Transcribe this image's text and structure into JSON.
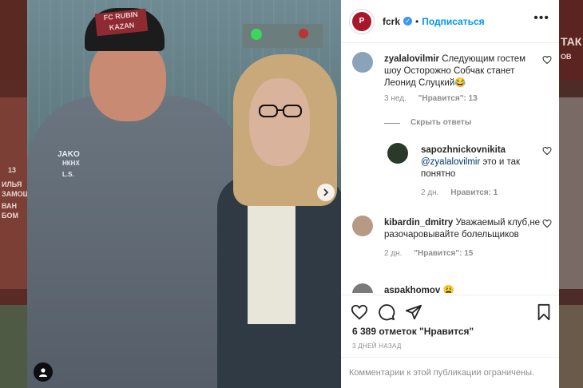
{
  "post": {
    "username": "fcrk",
    "follow_label": "Подписаться",
    "more_label": "•••",
    "dot": "•",
    "verified_mark": "✓",
    "club_emblem_text": "Р",
    "cap_text": "FC RUBIN KAZAN",
    "jacket_brand": "JAKO",
    "jacket_sponsor": "НКНХ",
    "jacket_initials": "L.S."
  },
  "comments": [
    {
      "username": "zyalalovilmir",
      "text": "Следующим гостем шоу Осторожно Собчак станет Леонид Слуцкий😂",
      "time": "3 нед.",
      "likes": "\"Нравится\": 13"
    },
    {
      "username": "sapozhnickovnikita",
      "mention": "@zyalalovilmir",
      "text": " это и так понятно",
      "time": "2 дн.",
      "likes": "Нравится: 1"
    },
    {
      "username": "kibardin_dmitry",
      "text": "Уважаемый клуб,не разочаровывайте болельщиков",
      "time": "2 дн.",
      "likes": "\"Нравится\": 15"
    },
    {
      "username": "aspakhomov",
      "text": " 😩"
    }
  ],
  "hide_replies_label": "Скрыть ответы",
  "likes_count": "6 389 отметок \"Нравится\"",
  "date_label": "3 ДНЕЙ НАЗАД",
  "comments_limited": "Комментарии к этой публикации ограничены.",
  "background": {
    "left_texts": [
      "13",
      "ИЛЬЯ",
      "ЗАМОШН",
      "ВАН",
      "БОМ"
    ],
    "right_texts": [
      "ТАК",
      "ОВ"
    ]
  },
  "colors": {
    "accent": "#0095f6",
    "club_red": "#a8162a",
    "mention": "#00376b"
  }
}
